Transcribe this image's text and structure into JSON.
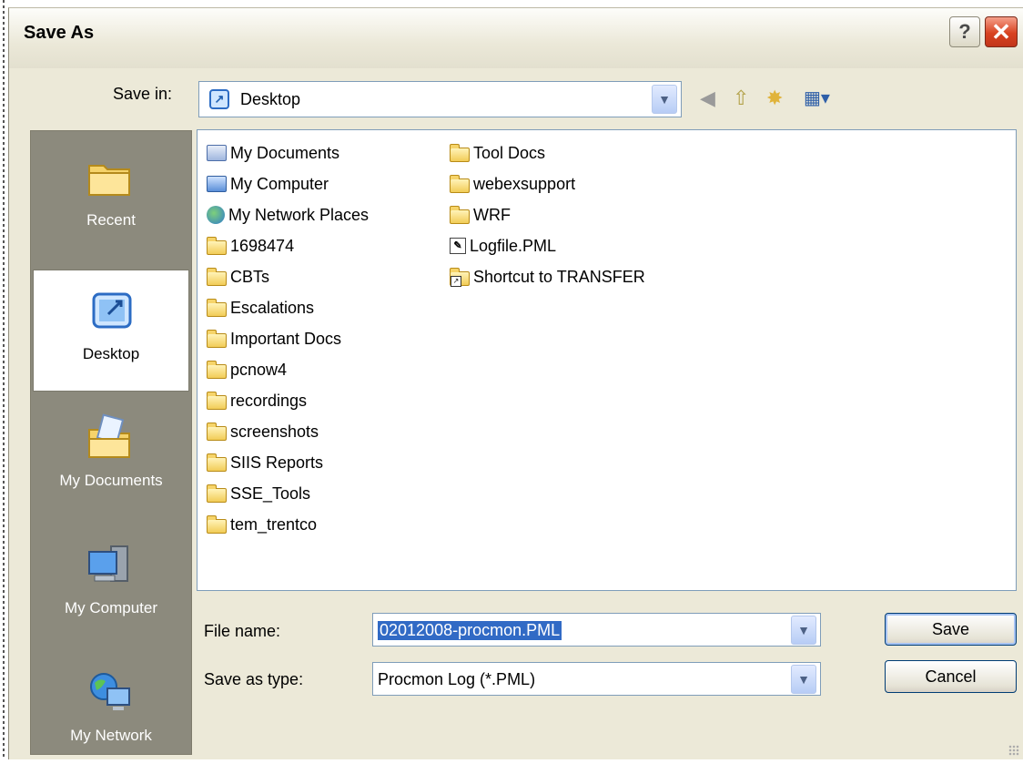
{
  "window": {
    "title": "Save As",
    "help_glyph": "?",
    "close_glyph": "✕"
  },
  "toolbar": {
    "save_in_label": "Save in:",
    "save_in_value": "Desktop",
    "icons": [
      "back-icon",
      "up-folder-icon",
      "new-folder-icon",
      "view-menu-icon"
    ]
  },
  "places": [
    {
      "label": "Recent",
      "icon": "recent-folder-icon"
    },
    {
      "label": "Desktop",
      "icon": "desktop-icon",
      "active": true
    },
    {
      "label": "My Documents",
      "icon": "my-documents-icon"
    },
    {
      "label": "My Computer",
      "icon": "my-computer-icon"
    },
    {
      "label": "My Network",
      "icon": "my-network-icon"
    }
  ],
  "files": {
    "column1": [
      {
        "name": "My Documents",
        "icon": "docs"
      },
      {
        "name": "My Computer",
        "icon": "comp"
      },
      {
        "name": "My Network Places",
        "icon": "net"
      },
      {
        "name": "1698474",
        "icon": "folder"
      },
      {
        "name": "CBTs",
        "icon": "folder"
      },
      {
        "name": "Escalations",
        "icon": "folder"
      },
      {
        "name": "Important Docs",
        "icon": "folder"
      },
      {
        "name": "pcnow4",
        "icon": "folder"
      },
      {
        "name": "recordings",
        "icon": "folder"
      },
      {
        "name": "screenshots",
        "icon": "folder"
      },
      {
        "name": "SIIS Reports",
        "icon": "folder"
      },
      {
        "name": "SSE_Tools",
        "icon": "folder"
      },
      {
        "name": "tem_trentco",
        "icon": "folder"
      }
    ],
    "column2": [
      {
        "name": "Tool Docs",
        "icon": "folder"
      },
      {
        "name": "webexsupport",
        "icon": "folder"
      },
      {
        "name": "WRF",
        "icon": "folder"
      },
      {
        "name": "Logfile.PML",
        "icon": "log"
      },
      {
        "name": "Shortcut to TRANSFER",
        "icon": "folder shortcut"
      }
    ]
  },
  "form": {
    "file_name_label": "File name:",
    "file_name_value": "02012008-procmon.PML",
    "save_type_label": "Save as type:",
    "save_type_value": "Procmon Log (*.PML)"
  },
  "buttons": {
    "save": "Save",
    "cancel": "Cancel"
  }
}
